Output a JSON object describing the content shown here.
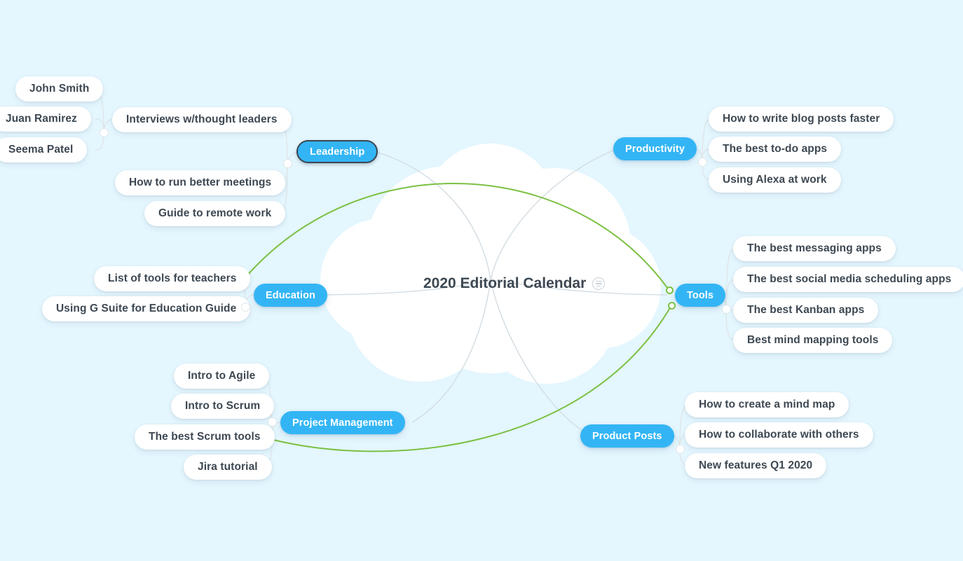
{
  "app": {
    "kind": "mind-map",
    "background_color": "#e4f6fe",
    "accent_color": "#33b5f5",
    "relationship_color": "#7bc043",
    "node_text_color": "#3d4852",
    "connector_color": "#dfe6ea"
  },
  "central": {
    "title": "2020 Editorial Calendar",
    "note_icon": "note-icon",
    "shape": "cloud"
  },
  "branches": [
    {
      "id": "leadership",
      "label": "Leadership",
      "side": "left",
      "selected": true,
      "children": [
        {
          "label": "Interviews w/thought leaders",
          "children": [
            {
              "label": "John Smith"
            },
            {
              "label": "Juan Ramirez"
            },
            {
              "label": "Seema Patel"
            }
          ]
        },
        {
          "label": "How to run better meetings"
        },
        {
          "label": "Guide to remote work"
        }
      ]
    },
    {
      "id": "education",
      "label": "Education",
      "side": "left",
      "selected": false,
      "children": [
        {
          "label": "List of tools for teachers"
        },
        {
          "label": "Using G Suite for Education Guide"
        }
      ]
    },
    {
      "id": "project-management",
      "label": "Project Management",
      "side": "left",
      "selected": false,
      "children": [
        {
          "label": "Intro to Agile"
        },
        {
          "label": "Intro to Scrum"
        },
        {
          "label": "The best Scrum tools"
        },
        {
          "label": "Jira tutorial"
        }
      ]
    },
    {
      "id": "productivity",
      "label": "Productivity",
      "side": "right",
      "selected": false,
      "children": [
        {
          "label": "How to write blog posts faster"
        },
        {
          "label": "The best to-do apps"
        },
        {
          "label": "Using Alexa at work"
        }
      ]
    },
    {
      "id": "tools",
      "label": "Tools",
      "side": "right",
      "selected": false,
      "children": [
        {
          "label": "The best messaging apps"
        },
        {
          "label": "The best social media scheduling apps"
        },
        {
          "label": "The best Kanban apps"
        },
        {
          "label": "Best mind mapping tools"
        }
      ]
    },
    {
      "id": "product-posts",
      "label": "Product Posts",
      "side": "right",
      "selected": false,
      "children": [
        {
          "label": "How to create a mind map"
        },
        {
          "label": "How to collaborate with others"
        },
        {
          "label": "New features Q1 2020"
        }
      ]
    }
  ],
  "relationships": [
    {
      "from": "tools",
      "to": "List of tools for teachers",
      "color": "#7bc043"
    },
    {
      "from": "tools",
      "to": "The best Scrum tools",
      "color": "#7bc043"
    }
  ]
}
